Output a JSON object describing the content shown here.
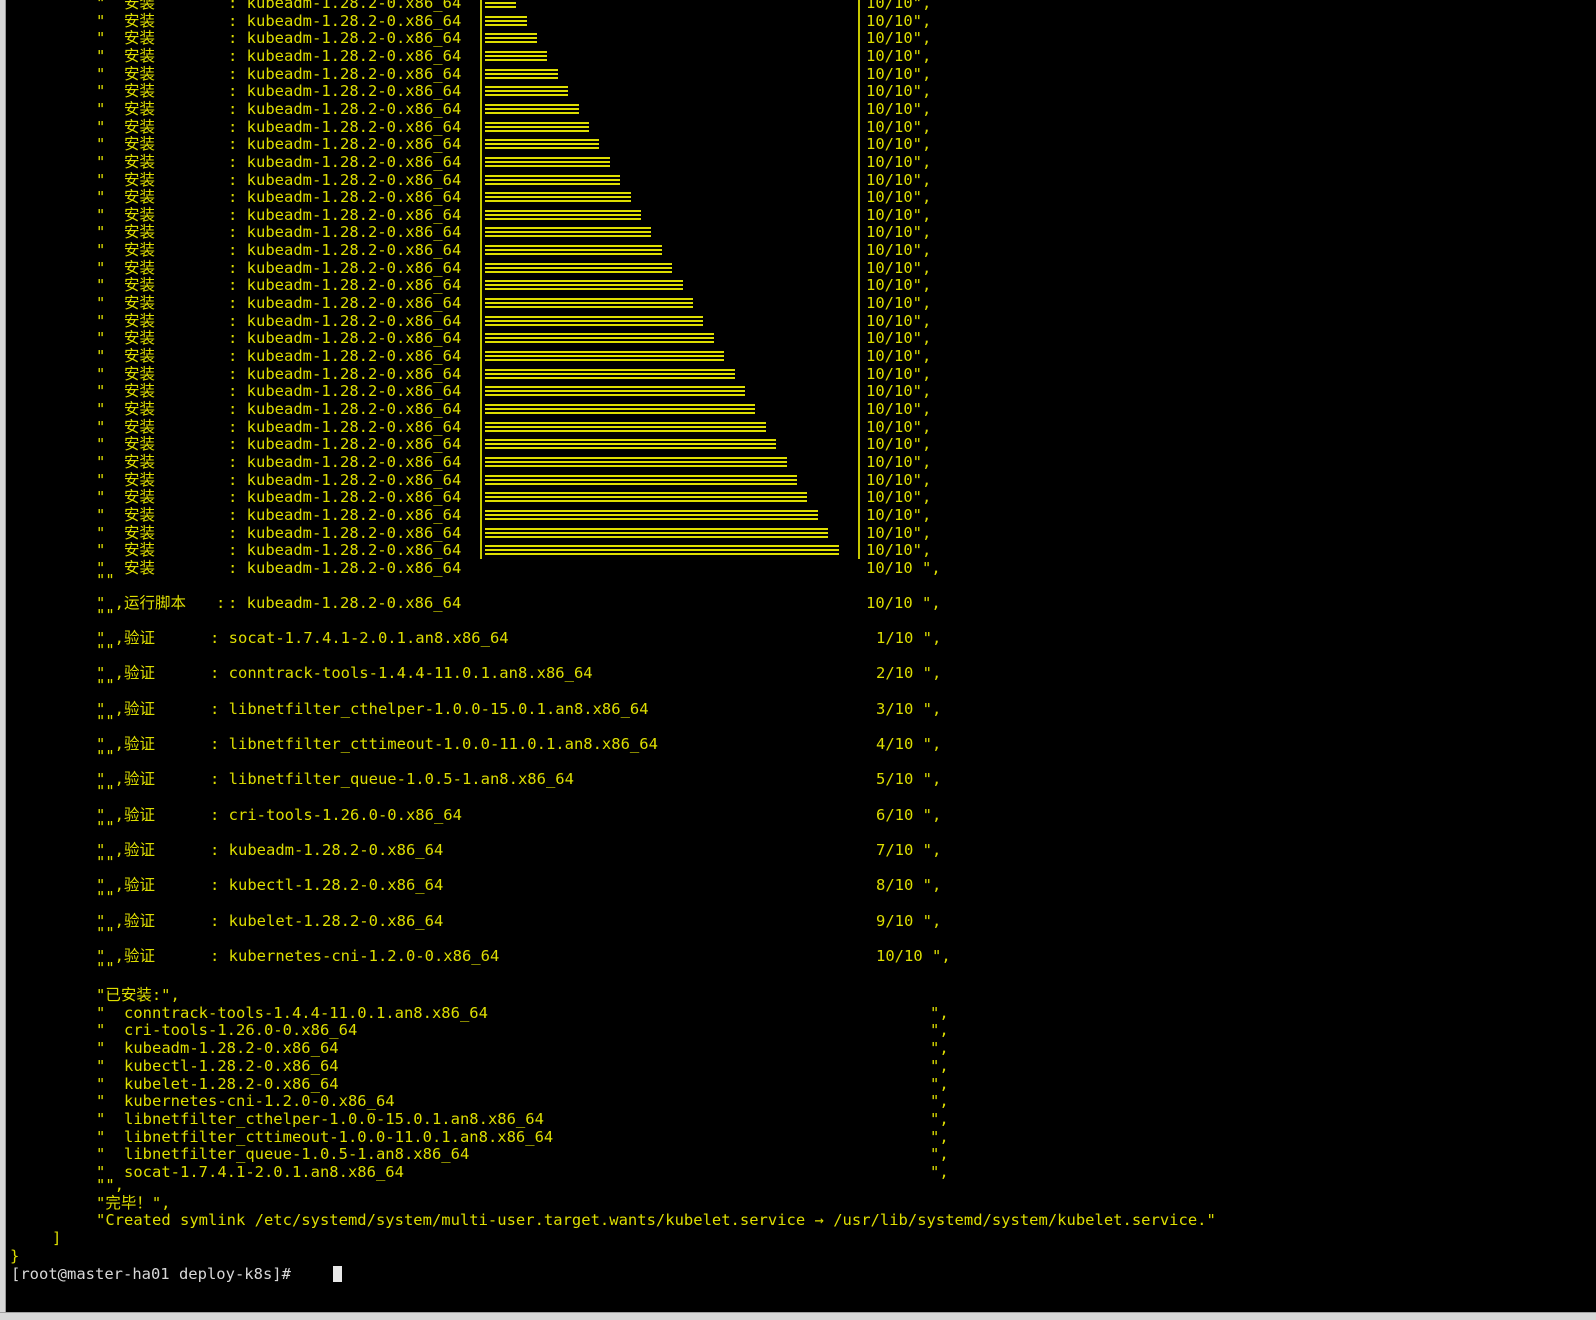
{
  "terminal": {
    "install_label": "安装",
    "runscript_label": "运行脚本",
    "verify_label": "验证",
    "installed_header": "\"已安装:\",",
    "done_line": "\"完毕！\",",
    "symlink_line": "\"Created symlink /etc/systemd/system/multi-user.target.wants/kubelet.service → /usr/lib/systemd/system/kubelet.service.\"",
    "close_bracket": "]",
    "close_brace": "}",
    "prompt": "[root@master-ha01 deploy-k8s]# ",
    "progress": {
      "package": ": kubeadm-1.28.2-0.x86_64",
      "count": "10/10\",",
      "final_count": "10/10 \",",
      "fills": [
        3,
        4,
        5,
        6,
        7,
        8,
        9,
        10,
        11,
        12,
        13,
        14,
        15,
        16,
        17,
        18,
        19,
        20,
        21,
        22,
        23,
        24,
        25,
        26,
        27,
        28,
        29,
        30,
        31,
        32,
        33,
        34
      ]
    },
    "runscript": {
      "package": ": kubeadm-1.28.2-0.x86_64",
      "count": "10/10 \","
    },
    "verify": [
      {
        "pkg": ": socat-1.7.4.1-2.0.1.an8.x86_64",
        "count": "1/10 \","
      },
      {
        "pkg": ": conntrack-tools-1.4.4-11.0.1.an8.x86_64",
        "count": "2/10 \","
      },
      {
        "pkg": ": libnetfilter_cthelper-1.0.0-15.0.1.an8.x86_64",
        "count": "3/10 \","
      },
      {
        "pkg": ": libnetfilter_cttimeout-1.0.0-11.0.1.an8.x86_64",
        "count": "4/10 \","
      },
      {
        "pkg": ": libnetfilter_queue-1.0.5-1.an8.x86_64",
        "count": "5/10 \","
      },
      {
        "pkg": ": cri-tools-1.26.0-0.x86_64",
        "count": "6/10 \","
      },
      {
        "pkg": ": kubeadm-1.28.2-0.x86_64",
        "count": "7/10 \","
      },
      {
        "pkg": ": kubectl-1.28.2-0.x86_64",
        "count": "8/10 \","
      },
      {
        "pkg": ": kubelet-1.28.2-0.x86_64",
        "count": "9/10 \","
      },
      {
        "pkg": ": kubernetes-cni-1.2.0-0.x86_64",
        "count": "10/10 \","
      }
    ],
    "installed": [
      "conntrack-tools-1.4.4-11.0.1.an8.x86_64",
      "cri-tools-1.26.0-0.x86_64",
      "kubeadm-1.28.2-0.x86_64",
      "kubectl-1.28.2-0.x86_64",
      "kubelet-1.28.2-0.x86_64",
      "kubernetes-cni-1.2.0-0.x86_64",
      "libnetfilter_cthelper-1.0.0-15.0.1.an8.x86_64",
      "libnetfilter_cttimeout-1.0.0-11.0.1.an8.x86_64",
      "libnetfilter_queue-1.0.5-1.an8.x86_64",
      "socat-1.7.4.1-2.0.1.an8.x86_64"
    ],
    "colors": {
      "background": "#000000",
      "text": "#dede00",
      "prompt": "#d8d8d8"
    }
  }
}
